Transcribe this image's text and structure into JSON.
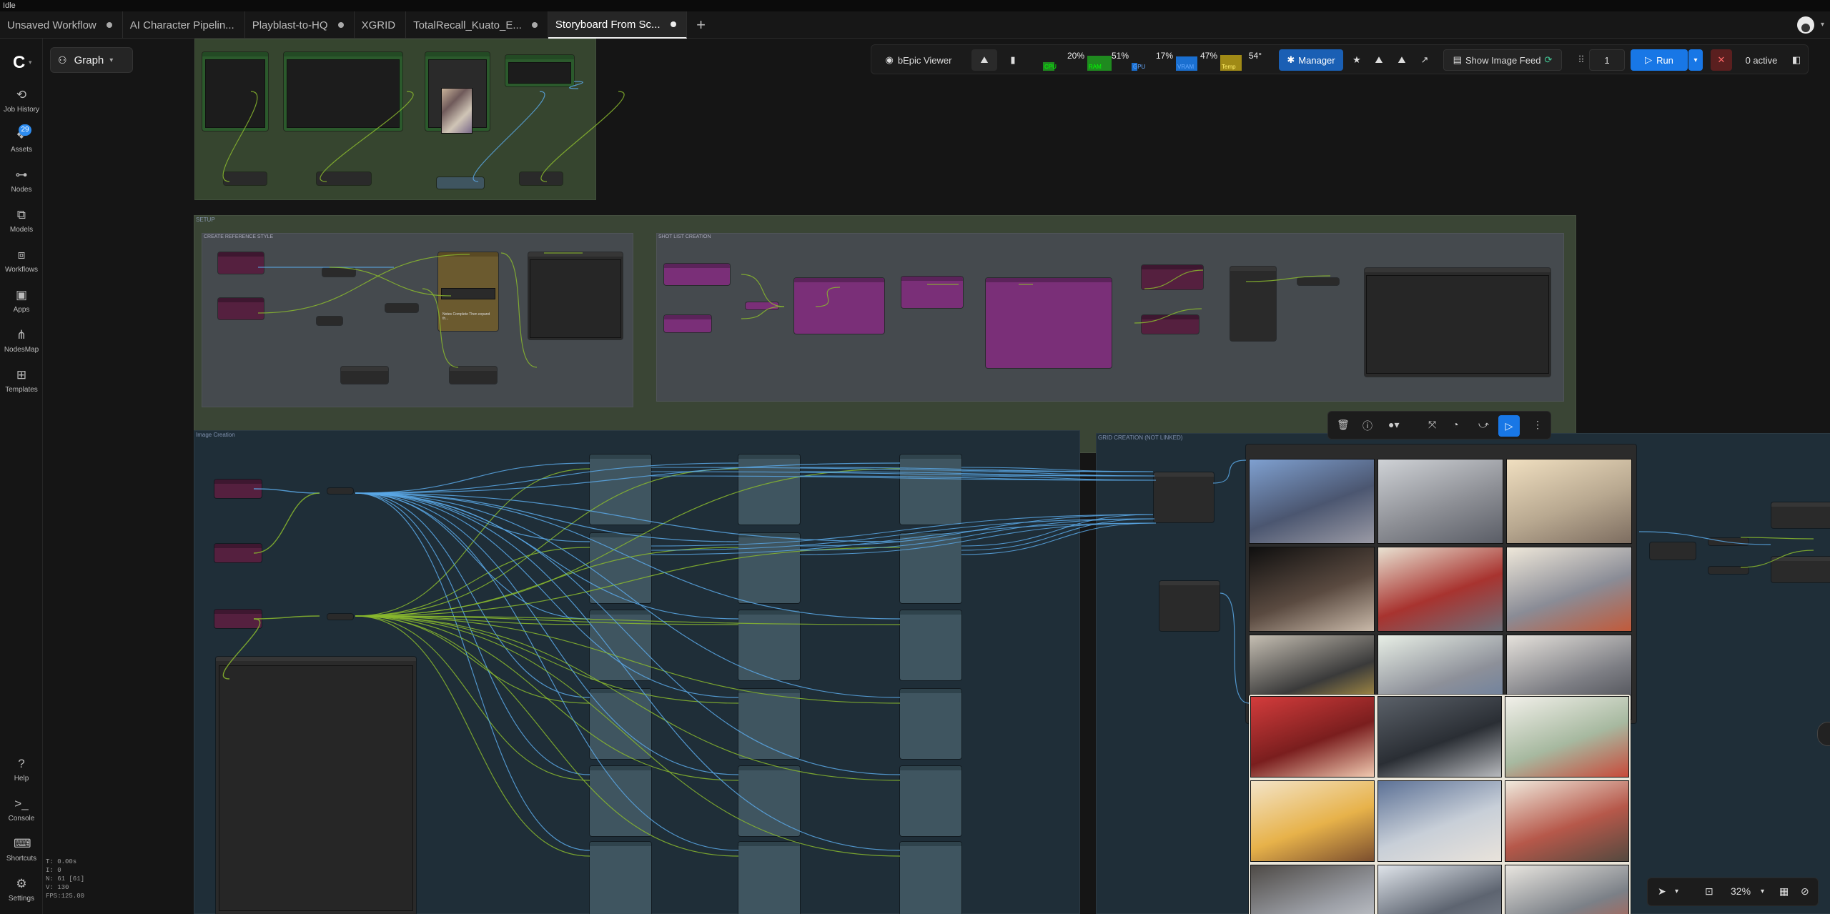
{
  "status": "Idle",
  "tabs": [
    {
      "label": "Unsaved Workflow",
      "modified": true
    },
    {
      "label": "AI Character Pipelin...",
      "modified": false
    },
    {
      "label": "Playblast-to-HQ",
      "modified": true
    },
    {
      "label": "XGRID",
      "modified": false
    },
    {
      "label": "TotalRecall_Kuato_E...",
      "modified": true
    },
    {
      "label": "Storyboard From Sc...",
      "modified": true,
      "active": true
    }
  ],
  "sidebar": {
    "items": [
      {
        "label": "Job History",
        "icon": "history-icon"
      },
      {
        "label": "Assets",
        "icon": "assets-icon",
        "badge": "29"
      },
      {
        "label": "Nodes",
        "icon": "nodes-icon"
      },
      {
        "label": "Models",
        "icon": "models-icon"
      },
      {
        "label": "Workflows",
        "icon": "workflows-icon"
      },
      {
        "label": "Apps",
        "icon": "apps-icon"
      },
      {
        "label": "NodesMap",
        "icon": "nodesmap-icon"
      },
      {
        "label": "Templates",
        "icon": "templates-icon"
      }
    ],
    "bottom": [
      {
        "label": "Help",
        "icon": "help-icon"
      },
      {
        "label": "Console",
        "icon": "console-icon"
      },
      {
        "label": "Shortcuts",
        "icon": "keyboard-icon"
      },
      {
        "label": "Settings",
        "icon": "gear-icon"
      }
    ]
  },
  "stats": {
    "t": "T: 0.00s",
    "i": "I: 0",
    "n": "N: 61 [61]",
    "v": "V: 130",
    "fps": "FPS:125.00"
  },
  "graph_button": "Graph",
  "toolbar": {
    "viewer": "bEpic Viewer",
    "cpu_label": "CPU",
    "cpu": "20%",
    "ram_label": "RAM",
    "ram": "51%",
    "gpu_label": "GPU",
    "gpu": "17%",
    "vram_label": "VRAM",
    "vram": "47%",
    "temp_label": "Temp",
    "temp": "54°",
    "manager": "Manager",
    "image_feed": "Show Image Feed",
    "queue_count": "1",
    "run": "Run",
    "active": "0 active",
    "meter_levels": {
      "cpu": 0.2,
      "ram": 0.51,
      "gpu": 0.17,
      "vram": 0.47,
      "temp": 0.54
    }
  },
  "groups": {
    "setup": "SETUP",
    "create_reference": "CREATE REFERENCE STYLE",
    "shot_list": "SHOT LIST CREATION",
    "image_creation": "Image Creation",
    "grid_creation": "GRID CREATION (NOT LINKED)"
  },
  "node_text": "Notes Complete\nThen expand th...",
  "zoom": "32%",
  "colors": {
    "accent": "#1877e6",
    "wire_blue": "#5aa8e6",
    "wire_green": "#8ab82e",
    "group_green": "#3c4a38",
    "group_blue": "#1d2a33"
  }
}
